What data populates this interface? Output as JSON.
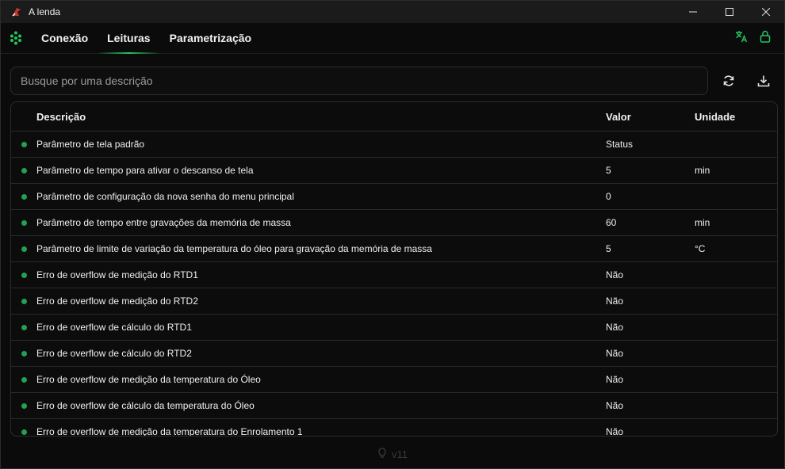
{
  "window": {
    "title": "A lenda"
  },
  "nav": {
    "tabs": [
      {
        "label": "Conexão",
        "active": false
      },
      {
        "label": "Leituras",
        "active": true
      },
      {
        "label": "Parametrização",
        "active": false
      }
    ],
    "accent": "#22c55e"
  },
  "search": {
    "placeholder": "Busque por uma descrição",
    "value": ""
  },
  "table": {
    "headers": {
      "description": "Descrição",
      "value": "Valor",
      "unit": "Unidade"
    },
    "rows": [
      {
        "description": "Parâmetro de tela padrão",
        "value": "Status",
        "unit": ""
      },
      {
        "description": "Parâmetro de tempo para ativar o descanso de tela",
        "value": "5",
        "unit": "min"
      },
      {
        "description": "Parâmetro de configuração da nova senha do menu principal",
        "value": "0",
        "unit": ""
      },
      {
        "description": "Parâmetro de tempo entre gravações da memória de massa",
        "value": "60",
        "unit": "min"
      },
      {
        "description": "Parâmetro de limite de variação da temperatura do óleo para gravação da memória de massa",
        "value": "5",
        "unit": "°C"
      },
      {
        "description": "Erro de overflow de medição do RTD1",
        "value": "Não",
        "unit": ""
      },
      {
        "description": "Erro de overflow de medição do RTD2",
        "value": "Não",
        "unit": ""
      },
      {
        "description": "Erro de overflow de cálculo do RTD1",
        "value": "Não",
        "unit": ""
      },
      {
        "description": "Erro de overflow de cálculo do RTD2",
        "value": "Não",
        "unit": ""
      },
      {
        "description": "Erro de overflow de medição da temperatura do Óleo",
        "value": "Não",
        "unit": ""
      },
      {
        "description": "Erro de overflow de cálculo da temperatura do Óleo",
        "value": "Não",
        "unit": ""
      },
      {
        "description": "Erro de overflow de medição da temperatura do Enrolamento 1",
        "value": "Não",
        "unit": ""
      }
    ],
    "status_color": "#22a152"
  },
  "footer": {
    "version": "v11"
  }
}
